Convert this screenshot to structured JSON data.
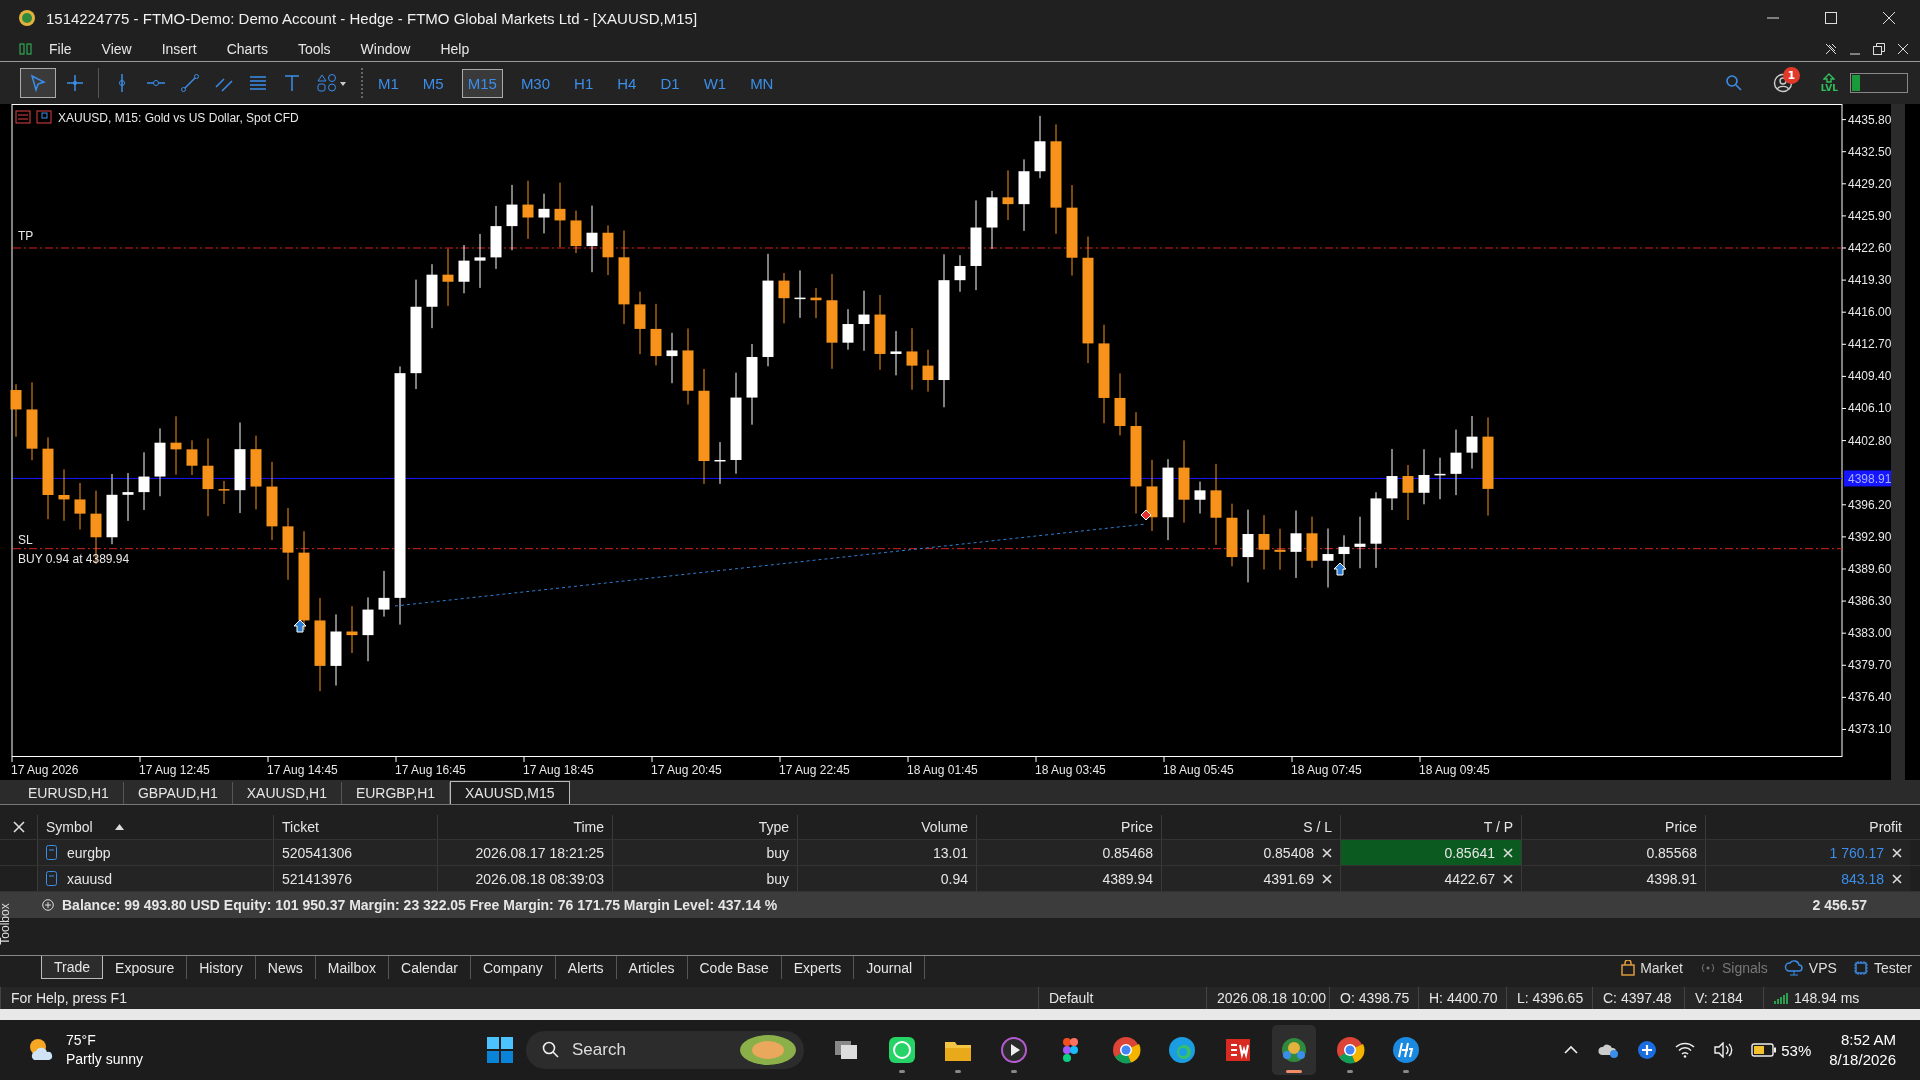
{
  "window": {
    "title": "1514224775 - FTMO-Demo: Demo Account - Hedge - FTMO Global Markets Ltd - [XAUUSD,M15]"
  },
  "menu": [
    "File",
    "View",
    "Insert",
    "Charts",
    "Tools",
    "Window",
    "Help"
  ],
  "timeframes": [
    {
      "label": "M1",
      "selected": false
    },
    {
      "label": "M5",
      "selected": false
    },
    {
      "label": "M15",
      "selected": true
    },
    {
      "label": "M30",
      "selected": false
    },
    {
      "label": "H1",
      "selected": false
    },
    {
      "label": "H4",
      "selected": false
    },
    {
      "label": "D1",
      "selected": false
    },
    {
      "label": "W1",
      "selected": false
    },
    {
      "label": "MN",
      "selected": false
    }
  ],
  "toolbar": {
    "notification_count": "1",
    "level_label": "LVL"
  },
  "chart": {
    "title": "XAUUSD, M15:  Gold vs US Dollar, Spot CFD",
    "tp_label": "TP",
    "sl_label": "SL",
    "order_label": "BUY 0.94 at 4389.94",
    "current_price": "4398.91",
    "price_ticks": [
      "4435.80",
      "4432.50",
      "4429.20",
      "4425.90",
      "4422.60",
      "4419.30",
      "4416.00",
      "4412.70",
      "4409.40",
      "4406.10",
      "4402.80",
      "4396.20",
      "4392.90",
      "4389.60",
      "4386.30",
      "4383.00",
      "4379.70",
      "4376.40",
      "4373.10"
    ],
    "time_labels": [
      "17 Aug 2026",
      "17 Aug 12:45",
      "17 Aug 14:45",
      "17 Aug 16:45",
      "17 Aug 18:45",
      "17 Aug 20:45",
      "17 Aug 22:45",
      "18 Aug 01:45",
      "18 Aug 03:45",
      "18 Aug 05:45",
      "18 Aug 07:45",
      "18 Aug 09:45"
    ]
  },
  "chart_tabs": [
    {
      "label": "EURUSD,H1",
      "selected": false
    },
    {
      "label": "GBPAUD,H1",
      "selected": false
    },
    {
      "label": "XAUUSD,H1",
      "selected": false
    },
    {
      "label": "EURGBP,H1",
      "selected": false
    },
    {
      "label": "XAUUSD,M15",
      "selected": true
    }
  ],
  "trade_table": {
    "columns": [
      "Symbol",
      "Ticket",
      "Time",
      "Type",
      "Volume",
      "Price",
      "S / L",
      "T / P",
      "Price",
      "Profit"
    ],
    "rows": [
      {
        "symbol": "eurgbp",
        "ticket": "520541306",
        "time": "2026.08.17 18:21:25",
        "type": "buy",
        "volume": "13.01",
        "price": "0.85468",
        "sl": "0.85408",
        "tp": "0.85641",
        "tp_highlight": true,
        "current_price": "0.85568",
        "profit": "1 760.17"
      },
      {
        "symbol": "xauusd",
        "ticket": "521413976",
        "time": "2026.08.18 08:39:03",
        "type": "buy",
        "volume": "0.94",
        "price": "4389.94",
        "sl": "4391.69",
        "tp": "4422.67",
        "tp_highlight": false,
        "current_price": "4398.91",
        "profit": "843.18"
      }
    ],
    "summary": "Balance: 99 493.80 USD  Equity: 101 950.37  Margin: 23 322.05  Free Margin: 76 171.75  Margin Level: 437.14 %",
    "total": "2 456.57"
  },
  "toolbox_label": "Toolbox",
  "bottom_tabs": [
    {
      "label": "Trade",
      "selected": true
    },
    {
      "label": "Exposure",
      "selected": false
    },
    {
      "label": "History",
      "selected": false
    },
    {
      "label": "News",
      "selected": false
    },
    {
      "label": "Mailbox",
      "selected": false
    },
    {
      "label": "Calendar",
      "selected": false
    },
    {
      "label": "Company",
      "selected": false
    },
    {
      "label": "Alerts",
      "selected": false
    },
    {
      "label": "Articles",
      "selected": false
    },
    {
      "label": "Code Base",
      "selected": false
    },
    {
      "label": "Experts",
      "selected": false
    },
    {
      "label": "Journal",
      "selected": false
    }
  ],
  "services": [
    {
      "kind": "market",
      "label": "Market",
      "disabled": false
    },
    {
      "kind": "signals",
      "label": "Signals",
      "disabled": true
    },
    {
      "kind": "vps",
      "label": "VPS",
      "disabled": false
    },
    {
      "kind": "tester",
      "label": "Tester",
      "disabled": false
    }
  ],
  "status_bar": {
    "help": "For Help, press F1",
    "profile": "Default",
    "time": "2026.08.18 10:00",
    "open": "O: 4398.75",
    "high": "H: 4400.70",
    "low": "L: 4396.65",
    "close": "C: 4397.48",
    "volume": "V: 2184",
    "ping": "148.94 ms"
  },
  "taskbar": {
    "temperature": "75°F",
    "weather": "Partly sunny",
    "search_label": "Search",
    "apps": [
      {
        "kind": "task-view",
        "active": false,
        "running": false
      },
      {
        "kind": "whatsapp",
        "active": false,
        "running": true
      },
      {
        "kind": "folder",
        "active": false,
        "running": true
      },
      {
        "kind": "player",
        "active": false,
        "running": true
      },
      {
        "kind": "figma",
        "active": false,
        "running": false
      },
      {
        "kind": "chrome",
        "active": false,
        "running": false
      },
      {
        "kind": "edge",
        "active": false,
        "running": false
      },
      {
        "kind": "solidworks",
        "active": false,
        "running": false
      },
      {
        "kind": "metatrader",
        "active": true,
        "running": true
      },
      {
        "kind": "chrome",
        "active": false,
        "running": true
      },
      {
        "kind": "hp",
        "active": false,
        "running": true
      }
    ],
    "battery": "53%",
    "time": "8:52 AM",
    "date": "8/18/2026"
  }
}
